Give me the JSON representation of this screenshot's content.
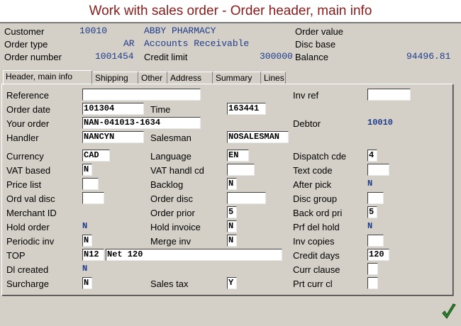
{
  "title": "Work with sales order - Order header, main info",
  "header": {
    "customer_label": "Customer",
    "customer_no": "10010",
    "customer_name": "ABBY PHARMACY",
    "order_type_label": "Order type",
    "order_type_code": "AR",
    "order_type_desc": "Accounts Receivable",
    "order_number_label": "Order number",
    "order_number": "1001454",
    "credit_limit_label": "Credit limit",
    "credit_limit": "300000",
    "order_value_label": "Order value",
    "disc_base_label": "Disc base",
    "balance_label": "Balance",
    "balance": "94496.81"
  },
  "tabs": [
    {
      "label": "Header, main info"
    },
    {
      "label": "Shipping"
    },
    {
      "label": "Other"
    },
    {
      "label": "Address"
    },
    {
      "label": "Summary"
    },
    {
      "label": "Lines"
    }
  ],
  "form": {
    "reference_label": "Reference",
    "reference": "",
    "order_date_label": "Order date",
    "order_date": "101304",
    "time_label": "Time",
    "time": "163441",
    "your_order_label": "Your order",
    "your_order": "NAN-041013-1634",
    "handler_label": "Handler",
    "handler": "NANCYN",
    "salesman_label": "Salesman",
    "salesman": "NOSALESMAN",
    "currency_label": "Currency",
    "currency": "CAD",
    "language_label": "Language",
    "language": "EN",
    "vat_based_label": "VAT based",
    "vat_based": "N",
    "vat_handl_label": "VAT handl cd",
    "vat_handl": "",
    "price_list_label": "Price list",
    "price_list": "",
    "backlog_label": "Backlog",
    "backlog": "N",
    "ord_val_disc_label": "Ord val disc",
    "ord_val_disc": "",
    "order_disc_label": "Order disc",
    "order_disc": "",
    "merchant_id_label": "Merchant ID",
    "order_prior_label": "Order prior",
    "order_prior": "5",
    "hold_order_label": "Hold order",
    "hold_order": "N",
    "hold_invoice_label": "Hold invoice",
    "hold_invoice": "N",
    "periodic_inv_label": "Periodic inv",
    "periodic_inv": "N",
    "merge_inv_label": "Merge inv",
    "merge_inv": "N",
    "top_label": "TOP",
    "top_code": "N12",
    "top_desc": "Net 120",
    "dl_created_label": "Dl created",
    "dl_created": "N",
    "surcharge_label": "Surcharge",
    "surcharge": "N",
    "sales_tax_label": "Sales tax",
    "sales_tax": "Y",
    "inv_ref_label": "Inv ref",
    "inv_ref": "",
    "debtor_label": "Debtor",
    "debtor": "10010",
    "dispatch_cde_label": "Dispatch cde",
    "dispatch_cde": "4",
    "text_code_label": "Text code",
    "text_code": "",
    "after_pick_label": "After pick",
    "after_pick": "N",
    "disc_group_label": "Disc group",
    "disc_group": "",
    "back_ord_pri_label": "Back ord pri",
    "back_ord_pri": "5",
    "prf_del_hold_label": "Prf del hold",
    "prf_del_hold": "N",
    "inv_copies_label": "Inv copies",
    "inv_copies": "",
    "credit_days_label": "Credit days",
    "credit_days": "120",
    "curr_clause_label": "Curr clause",
    "curr_clause": "",
    "prt_curr_cl_label": "Prt curr cl",
    "prt_curr_cl": ""
  },
  "icons": {
    "ok": "checkmark-icon"
  },
  "colors": {
    "title": "#8a1c1c",
    "value": "#1e3c8c",
    "background": "#d4d0c8"
  }
}
